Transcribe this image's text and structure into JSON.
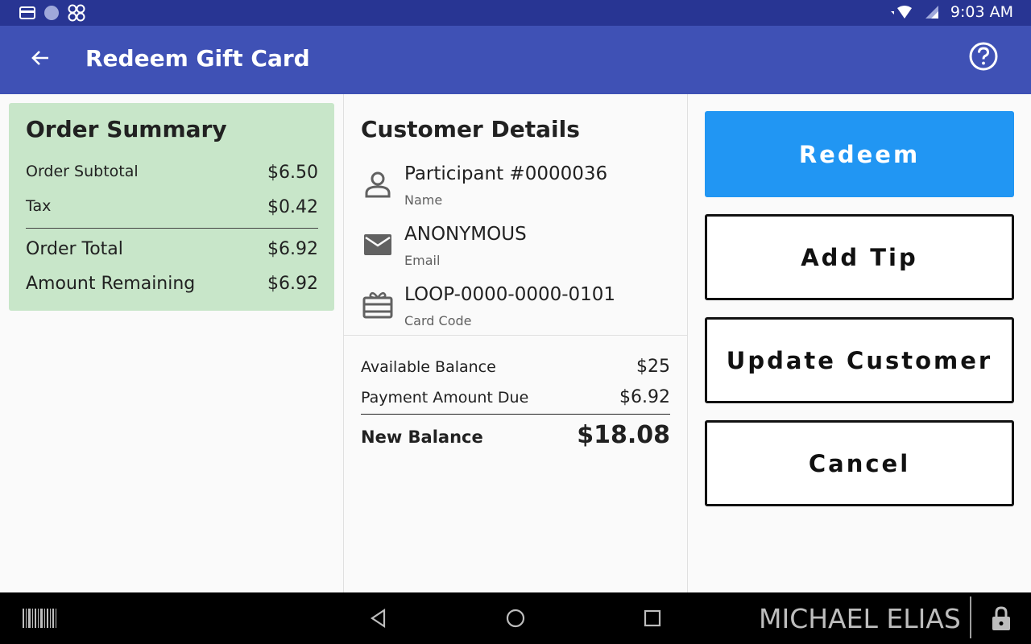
{
  "status_bar": {
    "time": "9:03 AM",
    "left_icons": [
      "card-icon",
      "circle-icon",
      "apps-icon"
    ],
    "right_icons": [
      "wifi-icon",
      "signal-icon"
    ]
  },
  "app_bar": {
    "title": "Redeem Gift Card",
    "back_icon": "arrow-back-icon",
    "help_icon": "help-icon"
  },
  "order_summary": {
    "title": "Order Summary",
    "rows": [
      {
        "label": "Order Subtotal",
        "value": "$6.50"
      },
      {
        "label": "Tax",
        "value": "$0.42"
      },
      {
        "label": "Order Total",
        "value": "$6.92"
      },
      {
        "label": "Amount Remaining",
        "value": "$6.92"
      }
    ]
  },
  "customer_details": {
    "title": "Customer Details",
    "items": [
      {
        "icon": "person-icon",
        "value": "Participant #0000036",
        "label": "Name"
      },
      {
        "icon": "mail-icon",
        "value": "ANONYMOUS",
        "label": "Email"
      },
      {
        "icon": "gift-card-icon",
        "value": "LOOP-0000-0000-0101",
        "label": "Card Code"
      }
    ],
    "balances": [
      {
        "label": "Available Balance",
        "value": "$25"
      },
      {
        "label": "Payment Amount Due",
        "value": "$6.92"
      }
    ],
    "new_balance": {
      "label": "New Balance",
      "value": "$18.08"
    }
  },
  "actions": {
    "redeem": "Redeem",
    "add_tip": "Add Tip",
    "update_customer": "Update Customer",
    "cancel": "Cancel"
  },
  "nav_bar": {
    "user_name": "MICHAEL ELIAS",
    "icons": [
      "barcode-icon",
      "nav-back-icon",
      "nav-home-icon",
      "nav-recents-icon",
      "lock-icon"
    ]
  },
  "colors": {
    "status_bar": "#283593",
    "app_bar": "#3f51b5",
    "summary_card": "#c8e6c9",
    "primary_button": "#2196f3"
  }
}
